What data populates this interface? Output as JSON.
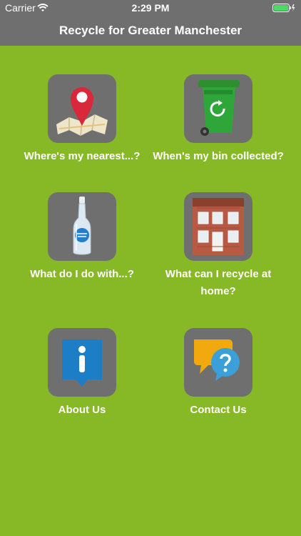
{
  "status": {
    "carrier": "Carrier",
    "time": "2:29 PM"
  },
  "header": {
    "title": "Recycle for Greater Manchester"
  },
  "menu": {
    "nearest": {
      "label": "Where's my nearest...?",
      "icon": "map-pin-icon"
    },
    "bin": {
      "label": "When's my bin collected?",
      "icon": "wheelie-bin-icon"
    },
    "what_do": {
      "label": "What do I do with...?",
      "icon": "bottle-icon"
    },
    "recycle_home": {
      "label_line1": "What can I recycle at",
      "label_line2": "home?",
      "icon": "house-icon"
    },
    "about": {
      "label": "About Us",
      "icon": "info-icon"
    },
    "contact": {
      "label": "Contact Us",
      "icon": "speech-bubbles-icon"
    }
  },
  "colors": {
    "background": "#86b925",
    "bar": "#6f6f6f",
    "tile": "#6f6f6f"
  }
}
